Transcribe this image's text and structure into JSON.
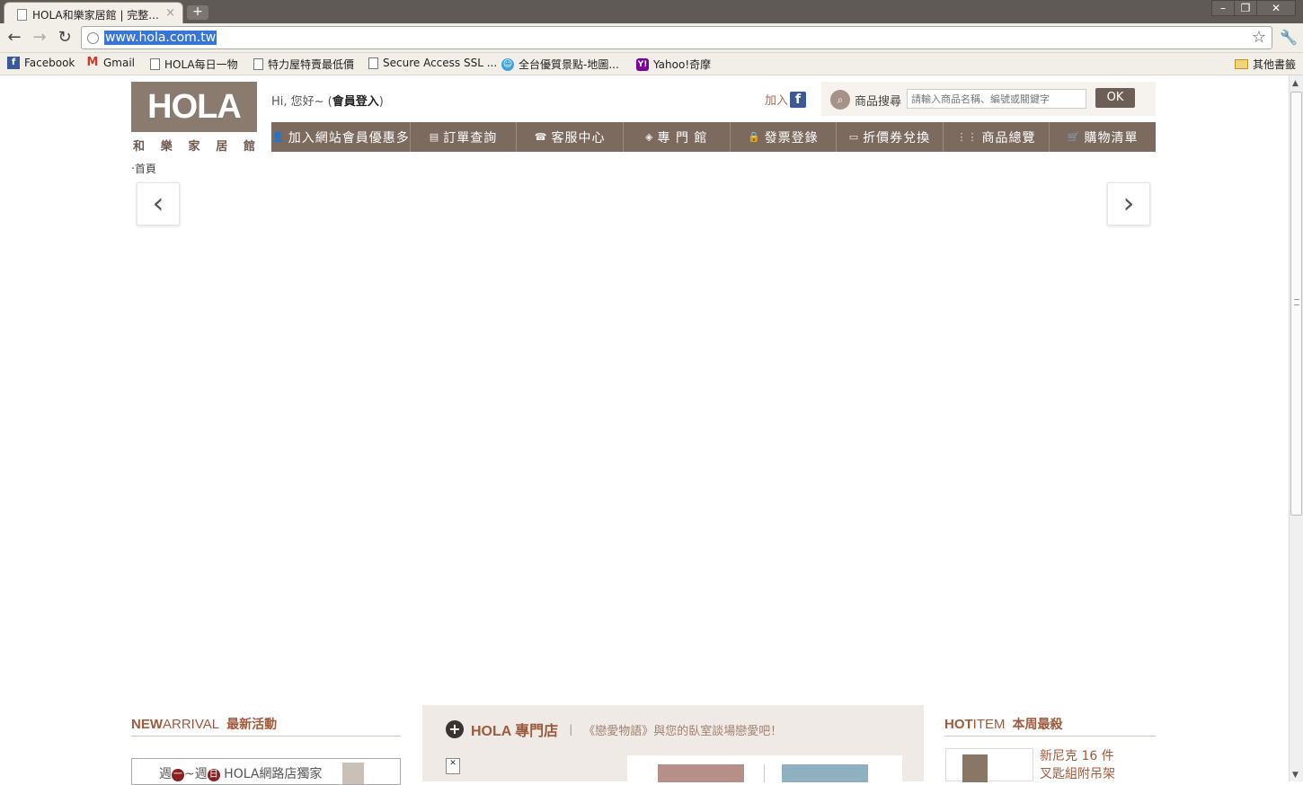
{
  "browser": {
    "tab_title": "HOLA和樂家居館 | 完整...",
    "tab_close": "×",
    "new_tab": "+",
    "window_controls": [
      "–",
      "❐",
      "✕"
    ],
    "url": "www.hola.com.tw",
    "bookmarks": [
      {
        "label": "Facebook",
        "icon": "facebook-icon"
      },
      {
        "label": "Gmail",
        "icon": "gmail-icon"
      },
      {
        "label": "HOLA每日一物",
        "icon": "page-icon"
      },
      {
        "label": "特力屋特賣最低價",
        "icon": "page-icon"
      },
      {
        "label": "Secure Access SSL ...",
        "icon": "page-icon"
      },
      {
        "label": "全台優質景點-地圖...",
        "icon": "smiley-icon"
      },
      {
        "label": "Yahoo!奇摩",
        "icon": "yahoo-icon"
      }
    ],
    "other_bookmarks": "其他書籤"
  },
  "header": {
    "logo_text": "HOLA",
    "logo_sub": [
      "和",
      "樂",
      "家",
      "居",
      "館"
    ],
    "greeting_prefix": "Hi, 您好~ (",
    "login_label": "會員登入",
    "greeting_suffix": ")",
    "join_label": "加入",
    "search_label": "商品搜尋",
    "search_placeholder": "請輸入商品名稱、編號或關鍵字",
    "search_button": "OK"
  },
  "nav": [
    {
      "label": "加入網站會員優惠多",
      "icon": "user-icon"
    },
    {
      "label": "訂單查詢",
      "icon": "clipboard-icon"
    },
    {
      "label": "客服中心",
      "icon": "phone-icon"
    },
    {
      "label": "專 門 館",
      "icon": "tag-icon"
    },
    {
      "label": "發票登錄",
      "icon": "lock-icon"
    },
    {
      "label": "折價券兌換",
      "icon": "coupon-icon"
    },
    {
      "label": "商品總覽",
      "icon": "grid-icon"
    },
    {
      "label": "購物清單",
      "icon": "cart-icon"
    }
  ],
  "breadcrumb": "‧首頁",
  "slider": {
    "prev": "‹",
    "next": "›"
  },
  "new_arrival": {
    "title_en_bold": "NEW",
    "title_en": "ARRIVAL",
    "title_cn": "最新活動",
    "banner_pre": "週",
    "day1": "一",
    "banner_mid": "~週",
    "day2": "日",
    "banner_text": " HOLA網路店獨家"
  },
  "store": {
    "plus": "+",
    "title": "HOLA 專門店",
    "separator": "|",
    "desc": "《戀愛物語》與您的臥室談場戀愛吧！"
  },
  "hot_item": {
    "title_en_bold": "HOT",
    "title_en": "ITEM",
    "title_cn": "本周最殺",
    "product_line1": "新尼克 16 件",
    "product_line2": "叉匙組附吊架"
  }
}
